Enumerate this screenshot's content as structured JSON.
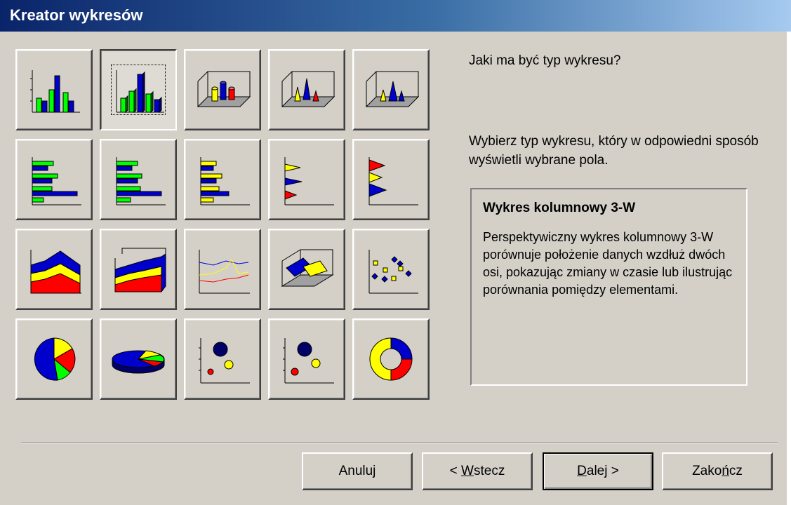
{
  "window": {
    "title": "Kreator wykresów"
  },
  "chart_types": [
    {
      "icon": "column-2d-icon"
    },
    {
      "icon": "column-3d-perspective-icon",
      "selected": true
    },
    {
      "icon": "cylinder-3d-icon"
    },
    {
      "icon": "cone-3d-icon"
    },
    {
      "icon": "pyramid-3d-icon"
    },
    {
      "icon": "bar-2d-icon"
    },
    {
      "icon": "bar-3d-icon"
    },
    {
      "icon": "cylinder-bar-icon"
    },
    {
      "icon": "cone-bar-icon"
    },
    {
      "icon": "pyramid-bar-icon"
    },
    {
      "icon": "area-2d-icon"
    },
    {
      "icon": "area-3d-icon"
    },
    {
      "icon": "line-2d-icon"
    },
    {
      "icon": "surface-3d-icon"
    },
    {
      "icon": "scatter-icon"
    },
    {
      "icon": "pie-2d-icon"
    },
    {
      "icon": "pie-3d-icon"
    },
    {
      "icon": "bubble-icon"
    },
    {
      "icon": "bubble-3d-icon"
    },
    {
      "icon": "doughnut-icon"
    }
  ],
  "panel": {
    "question": "Jaki ma być typ wykresu?",
    "instruction": "Wybierz typ wykresu, który w odpowiedni sposób wyświetli wybrane pola.",
    "description_title": "Wykres kolumnowy 3-W",
    "description_body": "Perspektywiczny wykres kolumnowy 3-W porównuje położenie danych wzdłuż dwóch osi, pokazując zmiany w czasie lub ilustrując porównania pomiędzy elementami."
  },
  "buttons": {
    "cancel": "Anuluj",
    "back_prefix": "< ",
    "back_mnemonic": "W",
    "back_rest": "stecz",
    "next_mnemonic": "D",
    "next_rest": "alej >",
    "finish_start": "Zako",
    "finish_mnemonic": "ń",
    "finish_end": "cz"
  },
  "colors": {
    "green": "#00ff00",
    "blue": "#0000cc",
    "yellow": "#ffff00",
    "red": "#ff0000"
  }
}
